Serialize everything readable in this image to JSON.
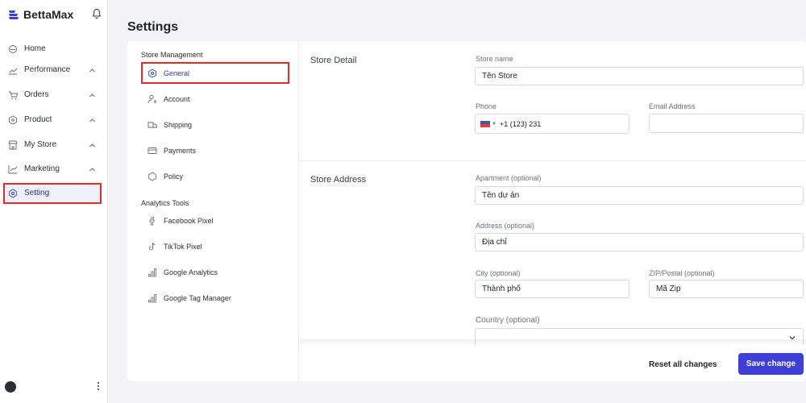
{
  "brand": {
    "name": "BettaMax",
    "logo_icon": "bettamax-logo-icon",
    "bell_icon": "bell-icon"
  },
  "sidebar": {
    "items": [
      {
        "label": "Home",
        "icon": "home-icon",
        "has_chevron": false
      },
      {
        "label": "Performance",
        "icon": "chart-icon",
        "has_chevron": true
      },
      {
        "label": "Orders",
        "icon": "cart-icon",
        "has_chevron": true
      },
      {
        "label": "Product",
        "icon": "box-icon",
        "has_chevron": true
      },
      {
        "label": "My Store",
        "icon": "store-icon",
        "has_chevron": true
      },
      {
        "label": "Marketing",
        "icon": "marketing-icon",
        "has_chevron": true
      },
      {
        "label": "Setting",
        "icon": "gear-icon",
        "has_chevron": false,
        "active": true
      }
    ]
  },
  "page": {
    "title": "Settings"
  },
  "settings_nav": {
    "store_management_title": "Store Management",
    "store_management": [
      {
        "label": "General",
        "icon": "hexagon-gear-icon",
        "active": true
      },
      {
        "label": "Account",
        "icon": "user-icon"
      },
      {
        "label": "Shipping",
        "icon": "truck-icon"
      },
      {
        "label": "Payments",
        "icon": "card-icon"
      },
      {
        "label": "Policy",
        "icon": "shield-icon"
      }
    ],
    "analytics_title": "Analytics Tools",
    "analytics": [
      {
        "label": "Facebook Pixel",
        "icon": "facebook-icon"
      },
      {
        "label": "TikTok Pixel",
        "icon": "tiktok-icon"
      },
      {
        "label": "Google Analytics",
        "icon": "bar-chart-icon"
      },
      {
        "label": "Google Tag Manager",
        "icon": "bar-chart-icon"
      }
    ]
  },
  "store_detail": {
    "section_label": "Store Detail",
    "store_name_label": "Store name",
    "store_name_value": "Tên Store",
    "phone_label": "Phone",
    "phone_value": "+1 (123) 231 ",
    "email_label": "Email Address",
    "email_value": ""
  },
  "store_address": {
    "section_label": "Store Address",
    "apartment_label": "Apartment (optional)",
    "apartment_value": "Tên dự án",
    "address_label": "Address (optional)",
    "address_value": "Địa chỉ",
    "city_label": "City (optional)",
    "city_value": "Thành phố",
    "zip_label": "ZIP/Postal (optional)",
    "zip_value": "Mã Zip",
    "country_label": "Country (optional)",
    "country_value": ""
  },
  "footer": {
    "reset_label": "Reset all changes",
    "save_label": "Save change"
  },
  "colors": {
    "accent": "#3d3fd6",
    "highlight_border": "#e22b2b",
    "active_bg": "#eef0fb"
  }
}
